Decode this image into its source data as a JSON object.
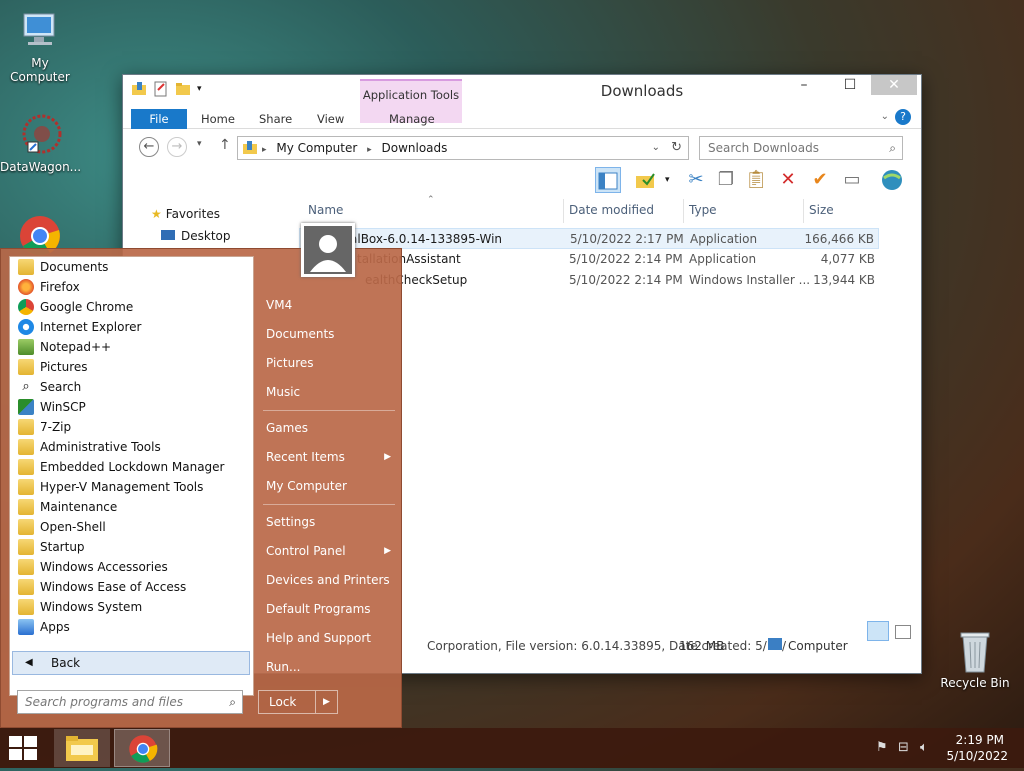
{
  "desktop": {
    "icons": [
      {
        "label": "My Computer"
      },
      {
        "label": "DataWagon..."
      },
      {
        "label": "Recycle Bin"
      }
    ]
  },
  "explorer": {
    "title": "Downloads",
    "context_tab": "Application Tools",
    "tabs": [
      "File",
      "Home",
      "Share",
      "View",
      "Manage"
    ],
    "address": {
      "segments": [
        "My Computer",
        "Downloads"
      ]
    },
    "search_placeholder": "Search Downloads",
    "nav": {
      "favorites": "Favorites",
      "items": [
        "Desktop"
      ]
    },
    "columns": [
      "Name",
      "Date modified",
      "Type",
      "Size"
    ],
    "files": [
      {
        "name": "alBox-6.0.14-133895-Win",
        "date": "5/10/2022 2:17 PM",
        "type": "Application",
        "size": "166,466 KB"
      },
      {
        "name": "tallationAssistant",
        "date": "5/10/2022 2:14 PM",
        "type": "Application",
        "size": "4,077 KB"
      },
      {
        "name": "ealthCheckSetup",
        "date": "5/10/2022 2:14 PM",
        "type": "Windows Installer ...",
        "size": "13,944 KB"
      }
    ],
    "status": {
      "details": "Corporation, File version: 6.0.14.33895, Date created: 5/10/",
      "size": "162 MB",
      "location": "Computer"
    }
  },
  "startmenu": {
    "programs": [
      {
        "label": "Documents",
        "icon": "folder-icon"
      },
      {
        "label": "Firefox",
        "icon": "firefox-icon"
      },
      {
        "label": "Google Chrome",
        "icon": "chrome-icon"
      },
      {
        "label": "Internet Explorer",
        "icon": "ie-icon"
      },
      {
        "label": "Notepad++",
        "icon": "notepad-icon"
      },
      {
        "label": "Pictures",
        "icon": "folder-icon"
      },
      {
        "label": "Search",
        "icon": "search-icon"
      },
      {
        "label": "WinSCP",
        "icon": "winscp-icon"
      },
      {
        "label": "7-Zip",
        "icon": "folder-icon"
      },
      {
        "label": "Administrative Tools",
        "icon": "folder-icon"
      },
      {
        "label": "Embedded Lockdown Manager",
        "icon": "folder-icon"
      },
      {
        "label": "Hyper-V Management Tools",
        "icon": "folder-icon"
      },
      {
        "label": "Maintenance",
        "icon": "folder-icon"
      },
      {
        "label": "Open-Shell",
        "icon": "folder-icon"
      },
      {
        "label": "Startup",
        "icon": "folder-icon"
      },
      {
        "label": "Windows Accessories",
        "icon": "folder-icon"
      },
      {
        "label": "Windows Ease of Access",
        "icon": "folder-icon"
      },
      {
        "label": "Windows System",
        "icon": "folder-icon"
      },
      {
        "label": "Apps",
        "icon": "apps-icon"
      }
    ],
    "back_label": "Back",
    "search_placeholder": "Search programs and files",
    "places": {
      "user": "VM4",
      "documents": "Documents",
      "pictures": "Pictures",
      "music": "Music",
      "games": "Games",
      "recent": "Recent Items",
      "computer": "My Computer",
      "settings": "Settings",
      "control_panel": "Control Panel",
      "devices": "Devices and Printers",
      "default_programs": "Default Programs",
      "help": "Help and Support",
      "run": "Run..."
    },
    "lock_label": "Lock"
  },
  "taskbar": {
    "time": "2:19 PM",
    "date": "5/10/2022"
  }
}
